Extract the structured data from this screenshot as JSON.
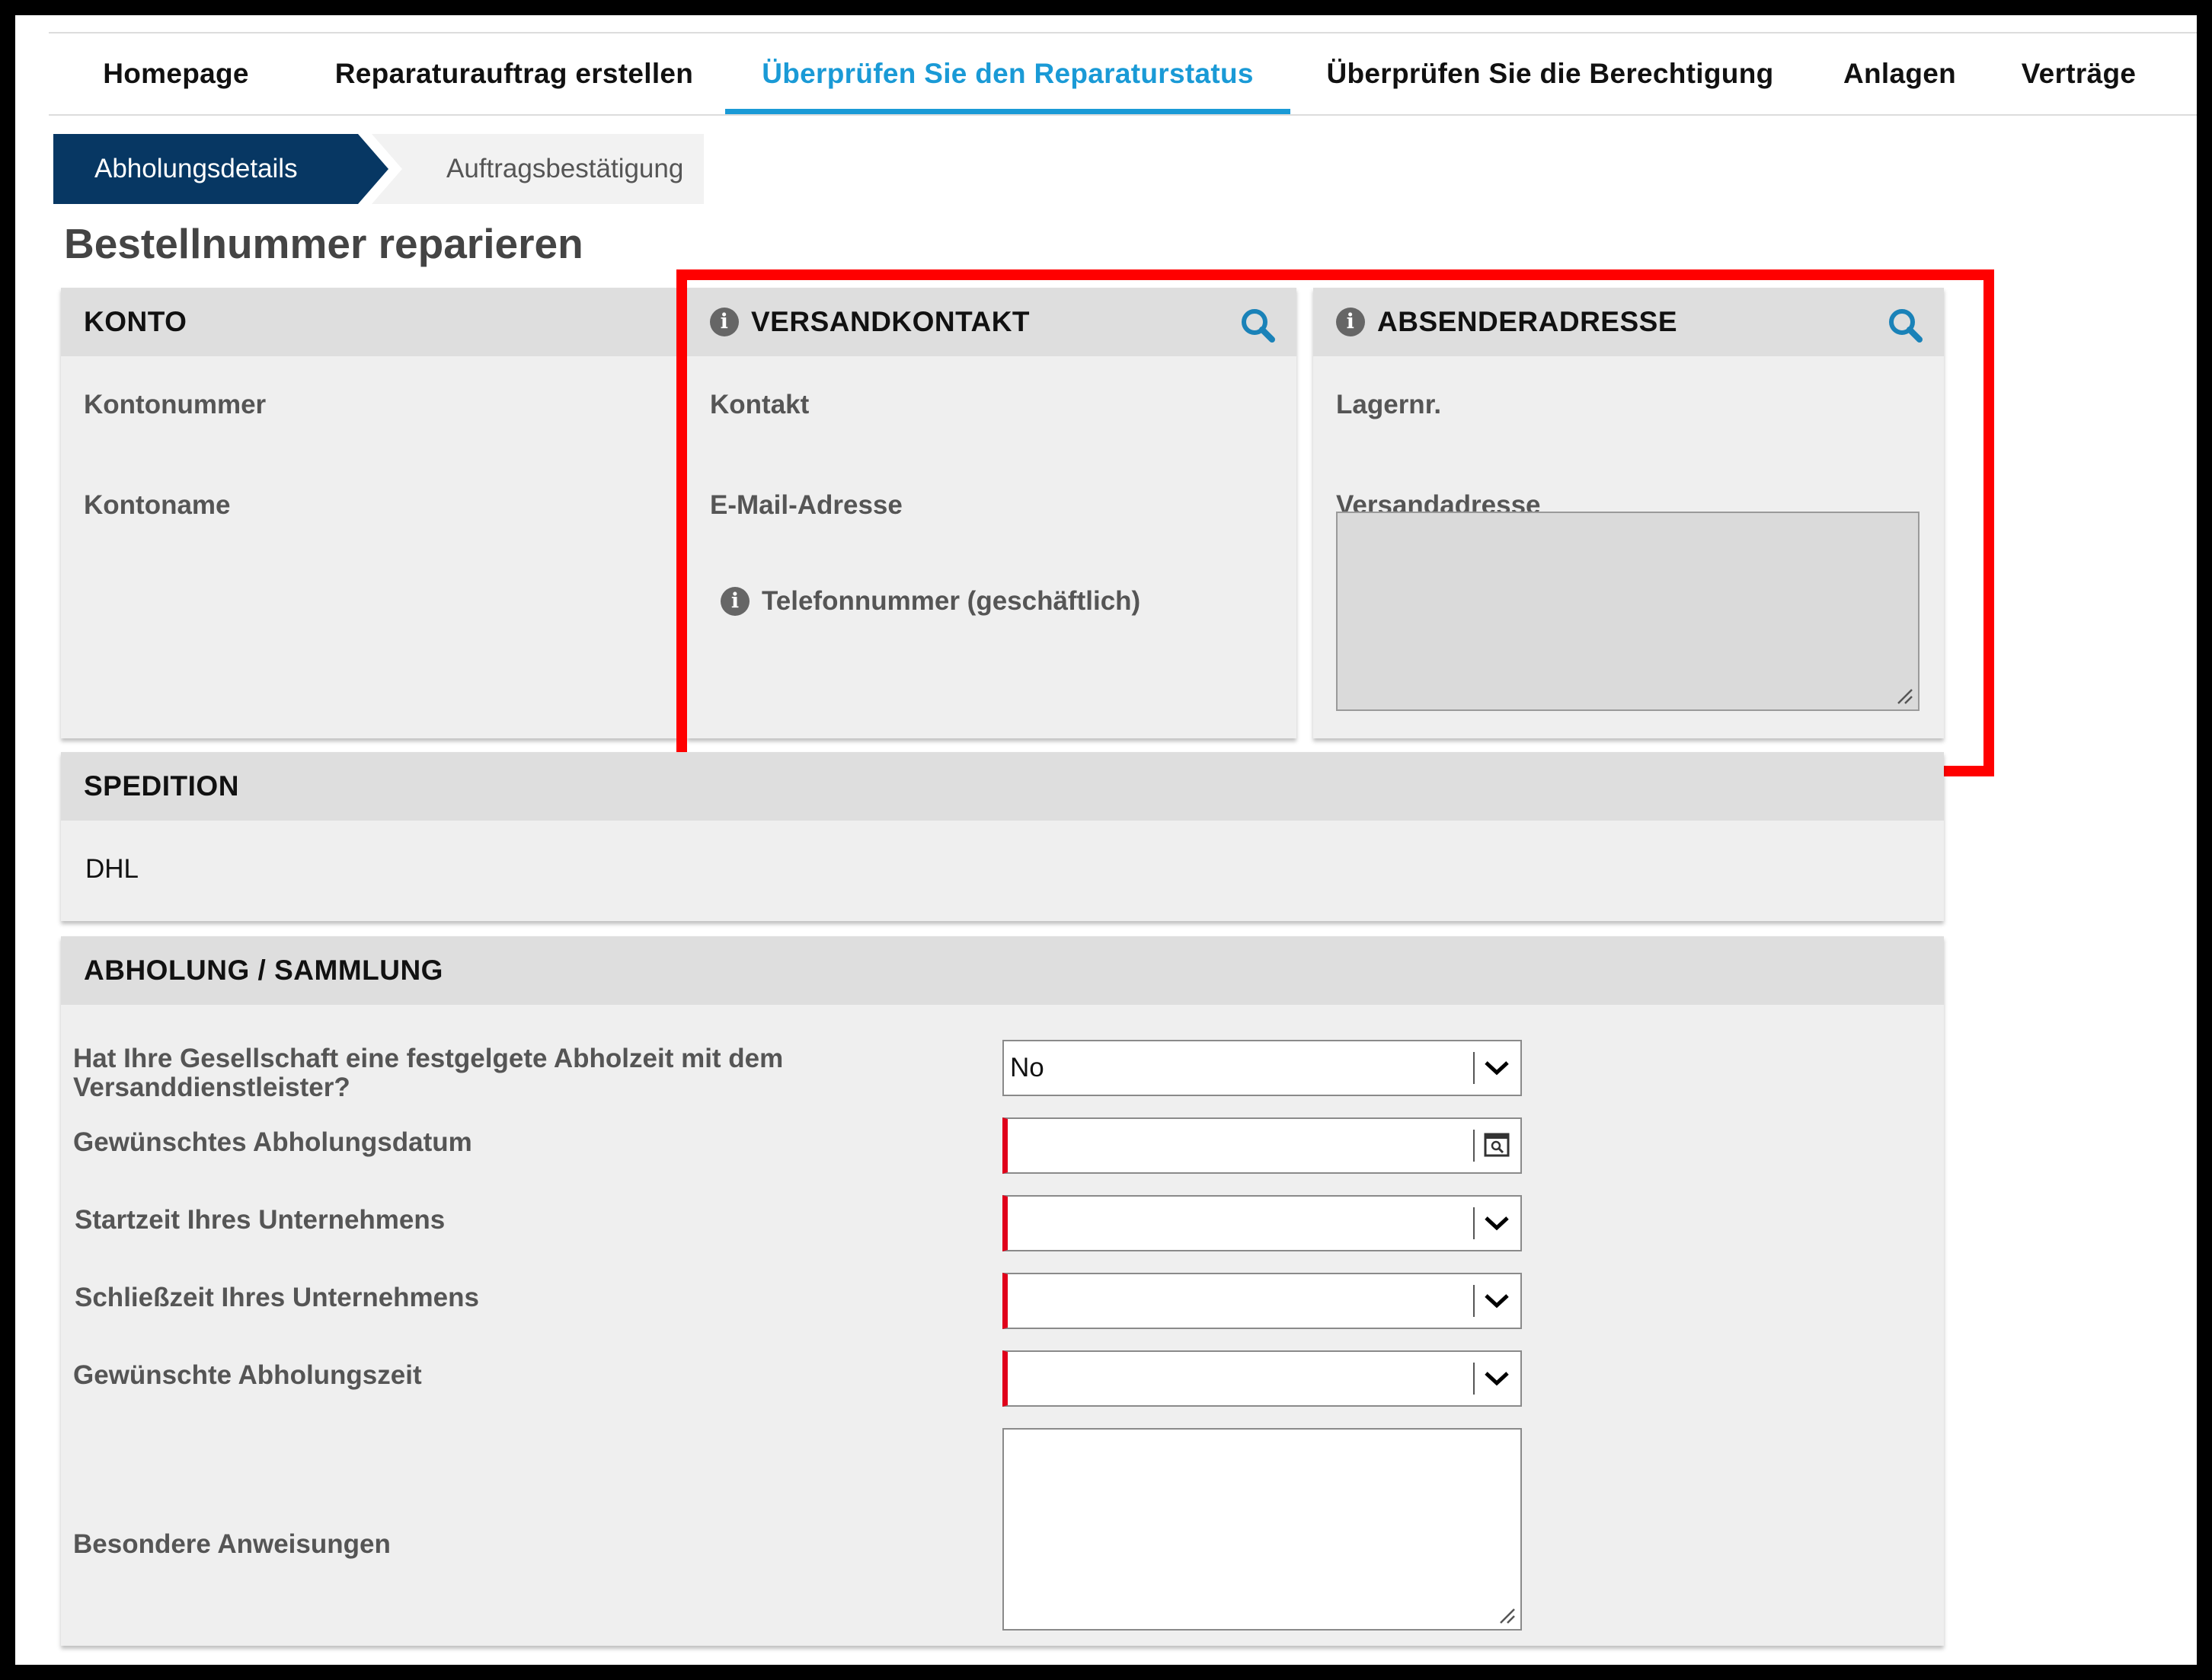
{
  "nav": {
    "items": [
      {
        "label": "Homepage"
      },
      {
        "label": "Reparaturauftrag erstellen"
      },
      {
        "label": "Überprüfen Sie den Reparaturstatus"
      },
      {
        "label": "Überprüfen Sie die Berechtigung"
      },
      {
        "label": "Anlagen"
      },
      {
        "label": "Verträge"
      }
    ],
    "active_index": 2,
    "active_color": "#1a9ad6"
  },
  "steps": {
    "current": "Abholungsdetails",
    "next": "Auftragsbestätigung",
    "current_color": "#073763"
  },
  "page": {
    "title": "Bestellnummer reparieren"
  },
  "konto": {
    "title": "KONTO",
    "kontonummer_label": "Kontonummer",
    "kontoname_label": "Kontoname"
  },
  "versandkontakt": {
    "title": "VERSANDKONTAKT",
    "kontakt_label": "Kontakt",
    "email_label": "E-Mail-Adresse",
    "telefon_label": "Telefonnummer (geschäftlich)"
  },
  "absenderadresse": {
    "title": "ABSENDERADRESSE",
    "lager_label": "Lagernr.",
    "versandadresse_label": "Versandadresse"
  },
  "spedition": {
    "title": "SPEDITION",
    "value": "DHL"
  },
  "abholung": {
    "title": "ABHOLUNG / SAMMLUNG",
    "fixed_time_label": "Hat Ihre Gesellschaft eine festgelgete Abholzeit mit dem Versanddienstleister?",
    "fixed_time_value": "No",
    "date_label": "Gewünschtes Abholungsdatum",
    "start_label": "Startzeit Ihres Unternehmens",
    "close_label": "Schließzeit Ihres Unternehmens",
    "pickup_time_label": "Gewünschte Abholungszeit",
    "instructions_label": "Besondere Anweisungen"
  },
  "colors": {
    "highlight": "#ff0000",
    "required": "#e0001b",
    "search_icon": "#1a82b8"
  }
}
